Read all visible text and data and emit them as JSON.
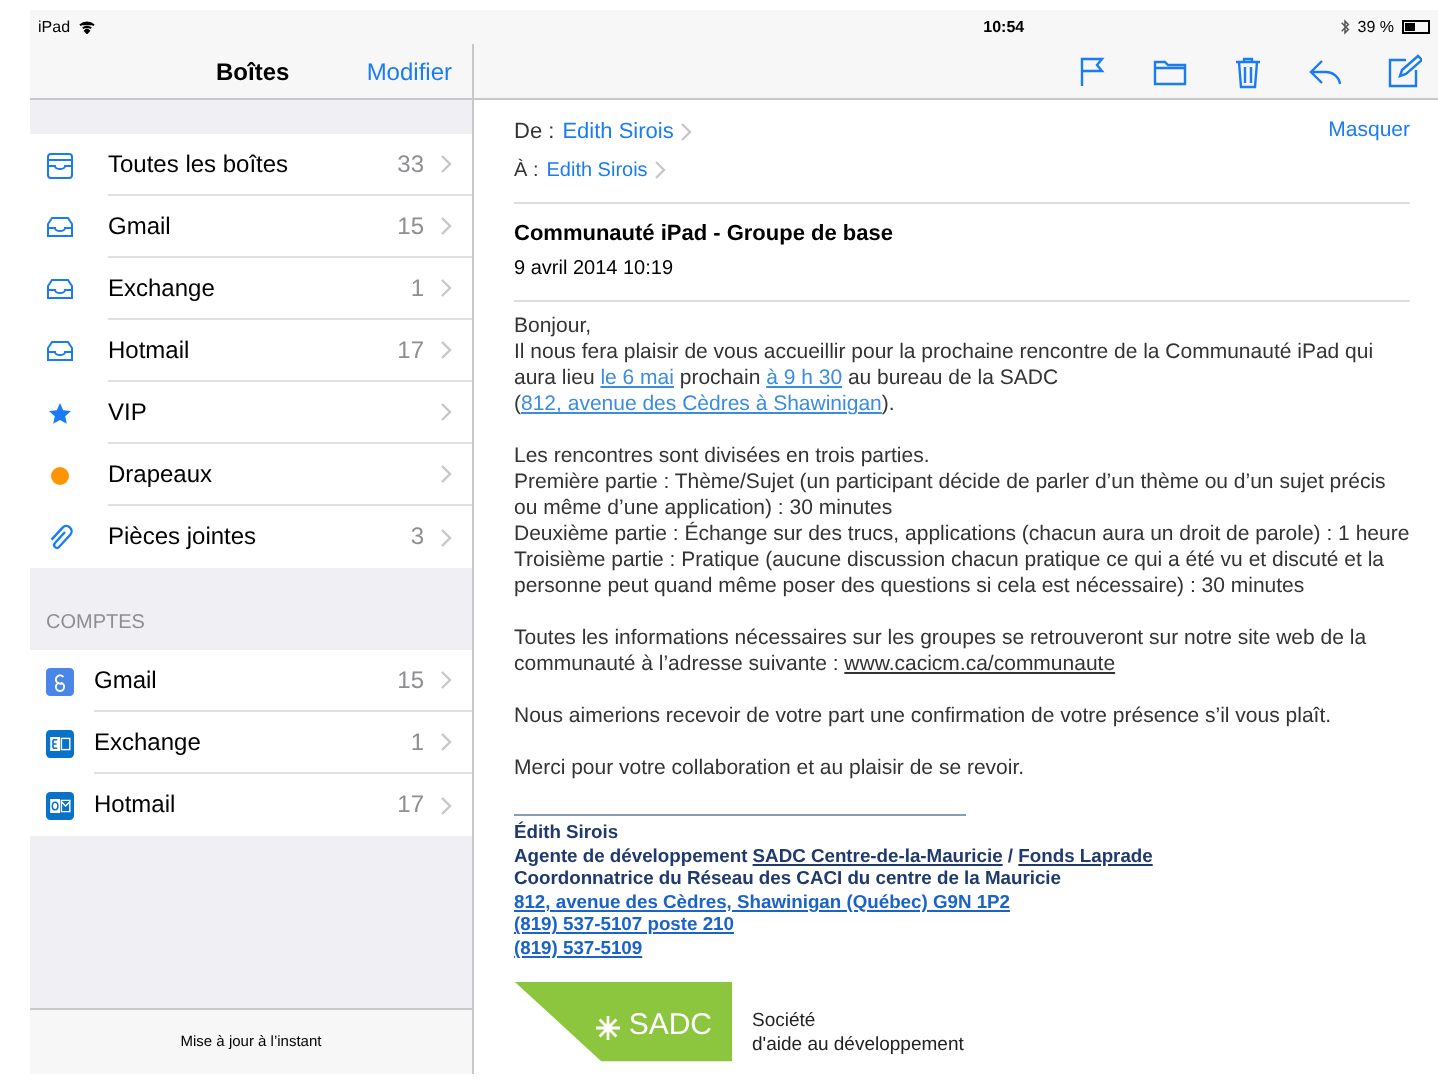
{
  "status_bar": {
    "device": "iPad",
    "time": "10:54",
    "battery": "39 %"
  },
  "sidebar": {
    "title": "Boîtes",
    "edit_button": "Modifier",
    "mailboxes": [
      {
        "kind": "all",
        "label": "Toutes les boîtes",
        "count": "33"
      },
      {
        "kind": "inbox",
        "label": "Gmail",
        "count": "15"
      },
      {
        "kind": "inbox",
        "label": "Exchange",
        "count": "1"
      },
      {
        "kind": "inbox",
        "label": "Hotmail",
        "count": "17"
      },
      {
        "kind": "vip",
        "label": "VIP"
      },
      {
        "kind": "flagged",
        "label": "Drapeaux"
      },
      {
        "kind": "attachments",
        "label": "Pièces jointes",
        "count": "3"
      }
    ],
    "accounts_header": "COMPTES",
    "accounts": [
      {
        "kind": "g-tile",
        "label": "Gmail",
        "count": "15"
      },
      {
        "kind": "e-tile",
        "label": "Exchange",
        "count": "1"
      },
      {
        "kind": "o-tile",
        "label": "Hotmail",
        "count": "17"
      }
    ],
    "footer": "Mise à jour à l’instant"
  },
  "message": {
    "from_label": "De :",
    "from": "Edith Sirois",
    "hide_button": "Masquer",
    "to_label": "À :",
    "to": "Edith Sirois",
    "subject": "Communauté iPad - Groupe de base",
    "date": "9 avril 2014 10:19",
    "body": [
      [
        [
          {
            "kind": "text",
            "text": "Bonjour,"
          }
        ],
        [
          {
            "kind": "text",
            "text": "Il nous fera plaisir de vous accueillir pour la prochaine rencontre de la Communauté iPad qui aura lieu "
          },
          {
            "kind": "link",
            "text": "le 6 mai"
          },
          {
            "kind": "text",
            "text": " prochain "
          },
          {
            "kind": "link",
            "text": "à 9 h 30"
          },
          {
            "kind": "text",
            "text": " au bureau de la SADC ("
          },
          {
            "kind": "link",
            "text": "812, avenue des Cèdres à Shawinigan"
          },
          {
            "kind": "text",
            "text": ")."
          }
        ]
      ],
      [
        [
          {
            "kind": "text",
            "text": "Les rencontres sont divisées en trois parties."
          }
        ],
        [
          {
            "kind": "text",
            "text": "Première partie : Thème/Sujet (un participant décide de parler d’un thème ou d’un sujet précis ou même d’une application) : 30 minutes"
          }
        ],
        [
          {
            "kind": "text",
            "text": "Deuxième partie : Échange sur des trucs, applications (chacun aura un droit de parole) : 1 heure"
          }
        ],
        [
          {
            "kind": "text",
            "text": "Troisième partie : Pratique (aucune discussion chacun pratique ce qui a été vu et discuté et la personne peut quand même poser des questions si cela est nécessaire) : 30 minutes"
          }
        ]
      ],
      [
        [
          {
            "kind": "text",
            "text": "Toutes les informations nécessaires sur les groupes se retrouveront sur notre site web de la communauté à l’adresse suivante : "
          },
          {
            "kind": "underlined",
            "text": "www.cacicm.ca/communaute"
          }
        ]
      ],
      [
        [
          {
            "kind": "text",
            "text": "Nous aimerions recevoir de votre part une confirmation de votre présence s’il vous plaît."
          }
        ]
      ],
      [
        [
          {
            "kind": "text",
            "text": "Merci pour votre collaboration et au plaisir de se revoir."
          }
        ]
      ]
    ],
    "signature": [
      [
        {
          "kind": "text",
          "text": "Édith Sirois"
        }
      ],
      [
        {
          "kind": "text",
          "text": "Agente de développement "
        },
        {
          "kind": "underlined",
          "text": "SADC Centre-de-la-Mauricie"
        },
        {
          "kind": "text",
          "text": " / "
        },
        {
          "kind": "underlined",
          "text": "Fonds Laprade"
        }
      ],
      [
        {
          "kind": "text",
          "text": "Coordonnatrice du Réseau des CACI du centre de la Mauricie"
        }
      ],
      [
        {
          "kind": "link",
          "text": "812, avenue des Cèdres, Shawinigan (Québec) G9N 1P2"
        }
      ],
      [
        {
          "kind": "link",
          "text": "(819) 537-5107 poste 210"
        }
      ],
      [
        {
          "kind": "link",
          "text": "(819) 537-5109"
        }
      ]
    ],
    "logo": {
      "name": "SADC",
      "tagline": [
        "Société",
        "d'aide au développement"
      ]
    }
  }
}
